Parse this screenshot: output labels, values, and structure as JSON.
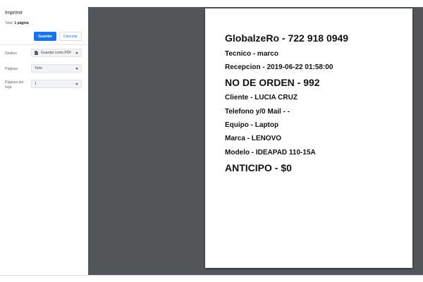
{
  "sidebar": {
    "title": "Imprimir",
    "summary_prefix": "Total: ",
    "summary_count": "1 página",
    "save_label": "Guardar",
    "cancel_label": "Cancelar",
    "destination": {
      "label": "Destino",
      "value": "Guardar como PDF",
      "icon": "pdf-file-icon"
    },
    "pages": {
      "label": "Páginas",
      "value": "Todo"
    },
    "pages_per_sheet": {
      "label": "Páginas por hoja",
      "value": "1"
    }
  },
  "document": {
    "lines": [
      "GlobalzeRo - 722 918 0949",
      "Tecnico - marco",
      "Recepcion - 2019-06-22 01:58:00",
      "NO DE ORDEN - 992",
      "Cliente - LUCIA CRUZ",
      "Telefono y/0 Mail - -",
      "Equipo - Laptop",
      "Marca - LENOVO",
      "Modelo - IDEAPAD 110-15A",
      "ANTICIPO - $0"
    ]
  },
  "colors": {
    "accent": "#1a73e8",
    "preview_background": "#525659"
  }
}
